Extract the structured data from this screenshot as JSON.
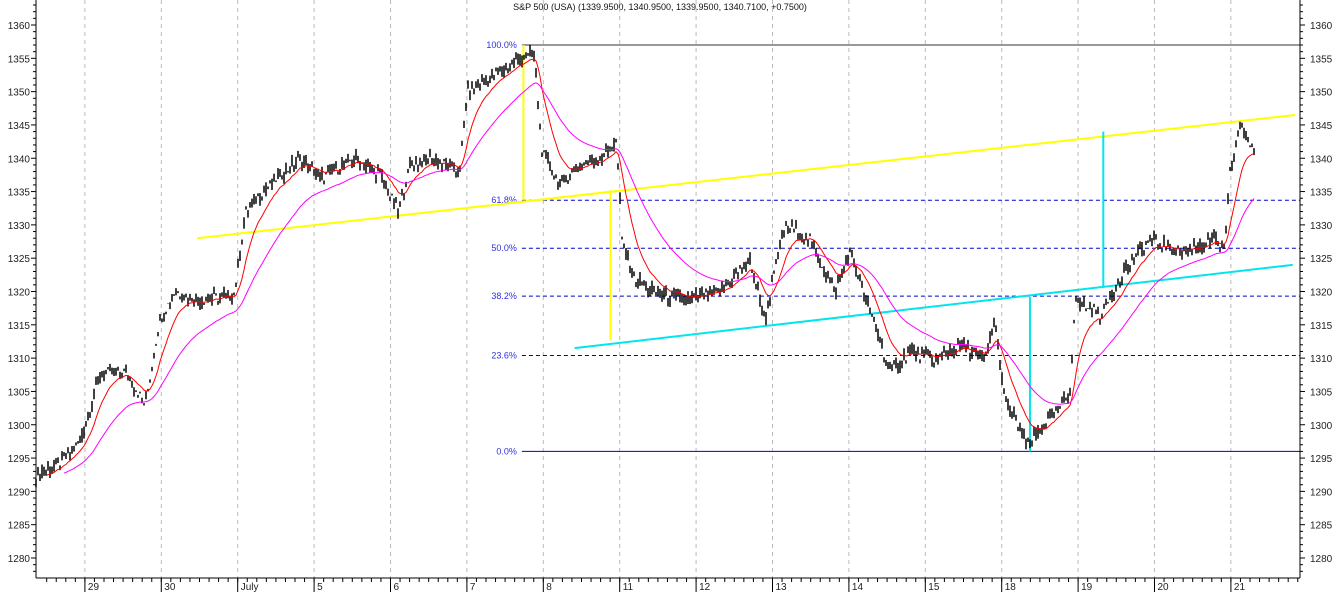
{
  "chart_data": {
    "type": "line",
    "title": "S&P 500 (USA) (1339.9500, 1340.9500, 1339.9500, 1340.7100, +0.7500)",
    "xlabel": "",
    "ylabel": "",
    "ylim": [
      1277,
      1364
    ],
    "yticks": [
      1280,
      1285,
      1290,
      1295,
      1300,
      1305,
      1310,
      1315,
      1320,
      1325,
      1330,
      1335,
      1340,
      1345,
      1350,
      1355,
      1360
    ],
    "xlim": [
      0.36,
      16.9
    ],
    "day_labels": [
      "29",
      "30",
      "July",
      "5",
      "6",
      "7",
      "8",
      "11",
      "12",
      "13",
      "14",
      "15",
      "18",
      "19",
      "20",
      "21"
    ],
    "price_path": [
      [
        0.36,
        1292.5
      ],
      [
        0.67,
        1294
      ],
      [
        0.94,
        1297.7
      ],
      [
        1.2,
        1307.5
      ],
      [
        1.52,
        1308
      ],
      [
        1.79,
        1303
      ],
      [
        1.98,
        1315.7
      ],
      [
        2.18,
        1320
      ],
      [
        2.51,
        1318.7
      ],
      [
        2.96,
        1319.5
      ],
      [
        3.1,
        1332
      ],
      [
        3.42,
        1336
      ],
      [
        3.82,
        1340
      ],
      [
        4.08,
        1337
      ],
      [
        4.54,
        1340
      ],
      [
        4.86,
        1337.5
      ],
      [
        5.1,
        1332
      ],
      [
        5.26,
        1339
      ],
      [
        5.52,
        1340
      ],
      [
        5.91,
        1338
      ],
      [
        6.0,
        1350
      ],
      [
        6.3,
        1352
      ],
      [
        6.76,
        1355.5
      ],
      [
        6.89,
        1355
      ],
      [
        6.98,
        1341
      ],
      [
        7.22,
        1336
      ],
      [
        7.48,
        1339
      ],
      [
        7.81,
        1340.5
      ],
      [
        7.96,
        1342.7
      ],
      [
        8.03,
        1327.7
      ],
      [
        8.2,
        1321.7
      ],
      [
        8.53,
        1319.5
      ],
      [
        8.92,
        1318.7
      ],
      [
        9.31,
        1320
      ],
      [
        9.71,
        1324.7
      ],
      [
        9.9,
        1315.7
      ],
      [
        10.16,
        1330
      ],
      [
        10.49,
        1327.7
      ],
      [
        10.82,
        1320
      ],
      [
        11.01,
        1326
      ],
      [
        11.28,
        1317
      ],
      [
        11.54,
        1308
      ],
      [
        11.8,
        1311
      ],
      [
        12.13,
        1309.7
      ],
      [
        12.45,
        1312
      ],
      [
        12.78,
        1309.7
      ],
      [
        12.91,
        1315.7
      ],
      [
        13.04,
        1303.7
      ],
      [
        13.34,
        1297
      ],
      [
        13.57,
        1300
      ],
      [
        13.89,
        1304.5
      ],
      [
        13.96,
        1318.7
      ],
      [
        14.29,
        1316.5
      ],
      [
        14.61,
        1323.2
      ],
      [
        14.94,
        1327.7
      ],
      [
        15.33,
        1326
      ],
      [
        15.79,
        1327.7
      ],
      [
        15.92,
        1326
      ],
      [
        15.99,
        1338
      ],
      [
        16.12,
        1345
      ],
      [
        16.32,
        1340.5
      ]
    ],
    "series": [
      {
        "name": "price",
        "color": "#000000"
      },
      {
        "name": "fast-ma",
        "color": "#ff0000",
        "period": 12
      },
      {
        "name": "slow-ma",
        "color": "#ff00ff",
        "period": 40
      }
    ],
    "fibonacci": {
      "start_day": 6.72,
      "high": 1357,
      "low": 1296,
      "color": "#0000cc",
      "levels": [
        {
          "pct": 100,
          "label": "100.0%"
        },
        {
          "pct": 61.8,
          "label": "61.8%"
        },
        {
          "pct": 50,
          "label": "50.0%"
        },
        {
          "pct": 38.2,
          "label": "38.2%"
        },
        {
          "pct": 23.6,
          "label": "23.6%"
        },
        {
          "pct": 0,
          "label": "0.0%"
        }
      ]
    },
    "trendlines": [
      {
        "name": "yellow-channel-line",
        "color": "#ffff00",
        "from": [
          2.47,
          1328
        ],
        "to": [
          16.84,
          1346.5
        ]
      },
      {
        "name": "cyan-channel-line",
        "color": "#00e5ee",
        "from": [
          7.41,
          1311.5
        ],
        "to": [
          16.81,
          1324
        ]
      },
      {
        "name": "yellow-measure-1",
        "color": "#ffff00",
        "from": [
          6.74,
          1357
        ],
        "to": [
          6.74,
          1333.7
        ]
      },
      {
        "name": "yellow-measure-2",
        "color": "#ffff00",
        "from": [
          7.88,
          1335.2
        ],
        "to": [
          7.88,
          1312.7
        ]
      },
      {
        "name": "cyan-measure-1",
        "color": "#00e5ee",
        "from": [
          13.37,
          1319.2
        ],
        "to": [
          13.37,
          1296
        ]
      },
      {
        "name": "cyan-measure-2",
        "color": "#00e5ee",
        "from": [
          14.33,
          1344
        ],
        "to": [
          14.33,
          1320.5
        ]
      }
    ],
    "grid": "vertical-dashed"
  }
}
